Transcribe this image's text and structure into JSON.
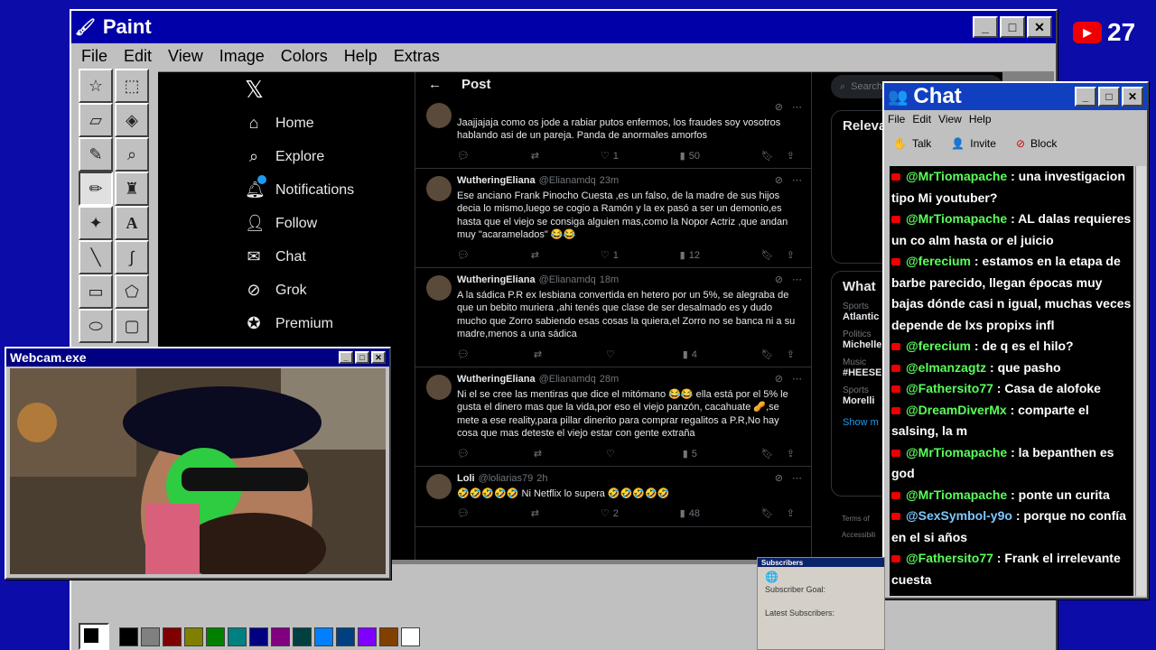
{
  "paint": {
    "title": "Paint",
    "menu": [
      "File",
      "Edit",
      "View",
      "Image",
      "Colors",
      "Help",
      "Extras"
    ],
    "tools": [
      "free-select",
      "select",
      "eraser",
      "fill",
      "picker",
      "magnifier",
      "pencil",
      "brush",
      "airbrush",
      "text",
      "line",
      "curve",
      "rectangle",
      "polygon",
      "ellipse",
      "rounded-rect"
    ],
    "palette": [
      "#000000",
      "#808080",
      "#800000",
      "#808000",
      "#008000",
      "#008080",
      "#000080",
      "#800080",
      "#004040",
      "#0080ff",
      "#004080",
      "#8000ff",
      "#804000",
      "#ffffff",
      "#c0c0c0",
      "#ff0000",
      "#ffff00",
      "#00ff00",
      "#00ffff",
      "#0000ff",
      "#ff00ff",
      "#ffff80",
      "#00ff80",
      "#80ffff",
      "#8080ff",
      "#ff0080",
      "#ff8040"
    ]
  },
  "twitter": {
    "nav": [
      "Home",
      "Explore",
      "Notifications",
      "Follow",
      "Chat",
      "Grok",
      "Premium"
    ],
    "header_title": "Post",
    "search_placeholder": "Search",
    "right_section1": "Releva",
    "right_section2": "What",
    "right_trends": [
      {
        "cat": "Sports",
        "name": "Atlantic"
      },
      {
        "cat": "Politics",
        "name": "Michelle"
      },
      {
        "cat": "Music",
        "name": "#HEESE"
      },
      {
        "cat": "Sports",
        "name": "Morelli"
      }
    ],
    "show_more": "Show m",
    "terms": "Terms of",
    "access": "Accessibili",
    "tweets": [
      {
        "name": "",
        "handle": "",
        "time": "",
        "text": "Jaajjajaja como os jode a rabiar putos enfermos, los fraudes soy vosotros hablando asi de un pareja. Panda de anormales amorfos",
        "likes": "1",
        "views": "50"
      },
      {
        "name": "WutheringEliana",
        "handle": "@Elianamdq",
        "time": "23m",
        "text": "Ese anciano Frank Pinocho Cuesta ,es un falso, de la madre de sus hijos decia lo mismo,luego se cogio a Ramón y la ex pasó a ser un demonio,es hasta que el viejo se consiga alguien mas,como la Nopor Actriz ,que andan muy \"acaramelados\" 😂😂",
        "likes": "1",
        "views": "12"
      },
      {
        "name": "WutheringEliana",
        "handle": "@Elianamdq",
        "time": "18m",
        "text": "A la sádica P.R ex lesbiana convertida en hetero por un 5%, se alegraba de que un bebito muriera ,ahi tenés que clase de ser desalmado es y dudo mucho que Zorro sabiendo esas cosas la quiera,el Zorro no se banca ni a su madre,menos a una sádica",
        "likes": "",
        "views": "4"
      },
      {
        "name": "WutheringEliana",
        "handle": "@Elianamdq",
        "time": "28m",
        "text": "Ni el se cree las mentiras que dice el mitómano 😂😂 ella está por el 5% le gusta el dinero mas que la vida,por eso el viejo panzón, cacahuate 🥜,se mete a ese reality,para pillar dinerito para comprar regalitos a P.R,No hay cosa que mas deteste el viejo estar con gente extraña",
        "likes": "",
        "views": "5"
      },
      {
        "name": "Loli",
        "handle": "@loliarias79",
        "time": "2h",
        "text": "🤣🤣🤣🤣🤣 Ni Netflix lo supera 🤣🤣🤣🤣🤣",
        "likes": "2",
        "views": "48"
      }
    ]
  },
  "chat": {
    "title": "Chat",
    "menu": [
      "File",
      "Edit",
      "View",
      "Help"
    ],
    "tools": [
      "Talk",
      "Invite",
      "Block"
    ],
    "messages": [
      {
        "user": "@MrTiomapache",
        "text": ": una investigacion tipo Mi youtuber?",
        "b": false
      },
      {
        "user": "@MrTiomapache",
        "text": ": AL dalas requieres un co alm hasta or el juicio",
        "b": false
      },
      {
        "user": "@ferecium",
        "text": ": estamos en la etapa de barbe parecido, llegan épocas muy bajas dónde casi n igual, muchas veces depende de lxs propixs infl",
        "b": false
      },
      {
        "user": "@ferecium",
        "text": ": de q es el hilo?",
        "b": false
      },
      {
        "user": "@elmanzagtz",
        "text": ": que pasho",
        "b": false
      },
      {
        "user": "@Fathersito77",
        "text": ": Casa de alofoke",
        "b": false
      },
      {
        "user": "@DreamDiverMx",
        "text": ": comparte el salsing, la m",
        "b": false
      },
      {
        "user": "@MrTiomapache",
        "text": ": la bepanthen es god",
        "b": false
      },
      {
        "user": "@MrTiomapache",
        "text": ": ponte un curita",
        "b": false
      },
      {
        "user": "@SexSymbol-y9o",
        "text": ": porque no confía en el si años",
        "b": true
      },
      {
        "user": "@Fathersito77",
        "text": ": Frank el irrelevante cuesta",
        "b": false
      }
    ]
  },
  "webcam": {
    "title": "Webcam.exe"
  },
  "subscribers": {
    "title": "Subscribers",
    "goal": "Subscriber Goal:",
    "latest": "Latest Subscribers:"
  },
  "yt_badge": {
    "count": "27"
  }
}
